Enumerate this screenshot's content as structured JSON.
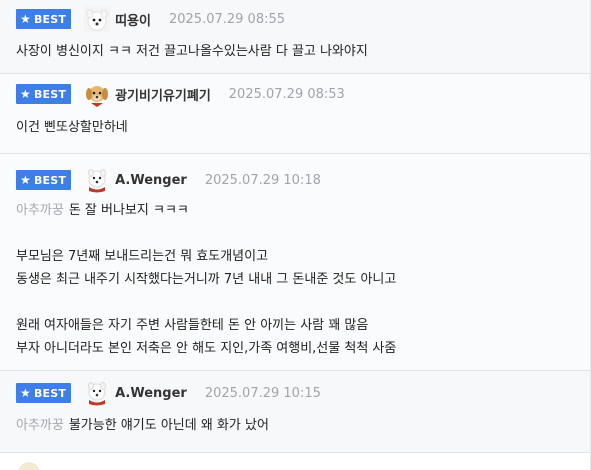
{
  "comments": [
    {
      "badge": "BEST",
      "nickname": "띠용이",
      "date": "2025.07.29 08:55",
      "avatar_icon": "white-dog-avatar",
      "lines": [
        "사장이 병신이지 ㅋㅋ 저건 끌고나올수있는사람 다 끌고 나와야지"
      ]
    },
    {
      "badge": "BEST",
      "nickname": "광기비기유기폐기",
      "date": "2025.07.29 08:53",
      "avatar_icon": "golden-puppy-avatar",
      "lines": [
        "이건 삔또상할만하네"
      ]
    },
    {
      "badge": "BEST",
      "nickname": "A.Wenger",
      "date": "2025.07.29 10:18",
      "avatar_icon": "white-dog-red-scarf-avatar",
      "mention": "아추까꿍",
      "first_line": "돈 잘 버나보지 ㅋㅋㅋ",
      "lines": [
        "",
        "부모님은 7년째 보내드리는건 뭐 효도개념이고",
        "동생은 최근 내주기 시작했다는거니까 7년 내내 그 돈내준 것도 아니고",
        "",
        "원래 여자애들은 자기 주변 사람들한테 돈 안 아끼는 사람 꽤 많음",
        "부자 아니더라도 본인 저축은 안 해도 지인,가족 여행비,선물 척척 사줌"
      ]
    },
    {
      "badge": "BEST",
      "nickname": "A.Wenger",
      "date": "2025.07.29 10:15",
      "avatar_icon": "white-dog-red-scarf-avatar",
      "mention": "아추까꿍",
      "first_line": "불가능한 얘기도 아닌데 왜 화가 났어"
    }
  ],
  "colors": {
    "badge": "#3e7ee8",
    "date": "#a0a4ab",
    "mention": "#a4a8b0"
  }
}
